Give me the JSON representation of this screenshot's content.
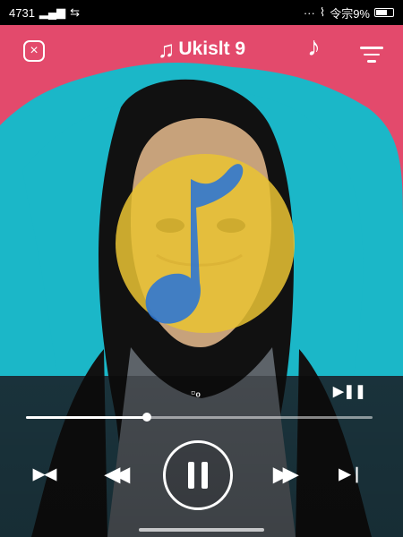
{
  "status_bar": {
    "left_text": "4731",
    "right_text": "令宗9%"
  },
  "header": {
    "title": "Ukislt 9"
  },
  "player": {
    "counter_text": "₀",
    "progress_fraction": 0.35
  },
  "icons": {
    "close": "close-icon",
    "title_note": "music-note-icon",
    "note_button": "music-note-icon",
    "menu": "menu-icon",
    "badge": "music-badge-icon",
    "small_play_pause": "play-pause-icon",
    "prev": "previous-icon",
    "play": "pause-icon",
    "next": "next-icon",
    "left_repeat": "repeat-icon",
    "right_skip": "skip-end-icon"
  },
  "colors": {
    "background_pink": "#e34a6c",
    "background_cyan": "#1bb7c8",
    "badge_yellow": "#e9c233",
    "badge_blue": "#2f77d2"
  }
}
